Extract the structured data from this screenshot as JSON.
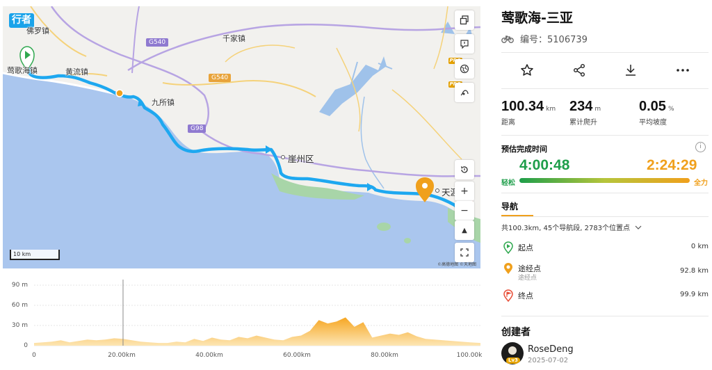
{
  "map": {
    "brand": "行者",
    "places": {
      "foluo": "佛罗镇",
      "yinggehai": "莺歌海镇",
      "huangliu": "黄流镇",
      "qianjia": "千家镇",
      "jiusuo": "九所镇",
      "yazhou": "崖州区",
      "tianya": "天涯"
    },
    "shields": {
      "g540a": "G540",
      "g540b": "G540",
      "g98": "G98"
    },
    "controls": {
      "layers_icon": "layers-icon",
      "note_icon": "note-icon",
      "globe_icon": "globe-icon",
      "terrain_icon": "terrain-icon",
      "reset_icon": "reset-icon",
      "zoom_in": "+",
      "zoom_out": "−",
      "north": "▲",
      "fullscreen_icon": "fullscreen-icon"
    },
    "pro_label": "PRO",
    "scale": "10 km",
    "attribution": "©高德地图   ©天地图",
    "colors": {
      "route": "#1ea8f0",
      "sea": "#aac6ee",
      "land": "#f2f1ee",
      "waypoint": "#f0a01c"
    }
  },
  "elevation": {
    "y_ticks": [
      "90 m",
      "60 m",
      "30 m",
      "0"
    ],
    "x_ticks": [
      "0",
      "20.00km",
      "40.00km",
      "60.00km",
      "80.00km",
      "100.00k"
    ],
    "fill_color": "#f7b731"
  },
  "chart_data": {
    "type": "area",
    "xlabel": "",
    "ylabel": "",
    "ylim": [
      0,
      90
    ],
    "xlim": [
      0,
      100.34
    ],
    "series": [
      {
        "x": [
          0,
          2,
          4,
          6,
          8,
          10,
          12,
          14,
          16,
          18,
          20,
          22,
          24,
          26,
          28,
          30,
          32,
          34,
          36,
          38,
          40,
          42,
          44,
          46,
          48,
          50,
          52,
          54,
          56,
          58,
          60,
          62,
          64,
          66,
          68,
          70,
          72,
          74,
          76,
          78,
          80,
          82,
          84,
          86,
          88,
          90,
          92,
          94,
          96,
          98,
          100.34
        ],
        "y": [
          4,
          5,
          6,
          8,
          5,
          7,
          9,
          8,
          9,
          11,
          10,
          8,
          6,
          5,
          4,
          4,
          6,
          5,
          10,
          7,
          12,
          9,
          8,
          13,
          11,
          15,
          12,
          9,
          8,
          13,
          15,
          22,
          38,
          33,
          36,
          42,
          28,
          35,
          12,
          15,
          18,
          16,
          20,
          14,
          10,
          9,
          8,
          7,
          6,
          5,
          4
        ]
      }
    ]
  },
  "cursor_km": 20,
  "panel": {
    "title": "莺歌海-三亚",
    "route_no": "编号：5106739",
    "actions": [
      "star-icon",
      "share-icon",
      "download-icon",
      "more-icon"
    ],
    "stats": [
      {
        "value": "100.34",
        "unit": "km",
        "label": "距离"
      },
      {
        "value": "234",
        "unit": "m",
        "label": "累计爬升"
      },
      {
        "value": "0.05",
        "unit": "%",
        "label": "平均坡度"
      }
    ],
    "eta": {
      "title": "预估完成时间",
      "easy_time": "4:00:48",
      "hard_time": "2:24:29",
      "easy_label": "轻松",
      "hard_label": "全力",
      "info": "i"
    },
    "nav": {
      "title": "导航",
      "summary": "共100.3km, 45个导航段, 2783个位置点",
      "waypoints": [
        {
          "name": "起点",
          "sub": "",
          "dist": "0 km",
          "color": "#2fa84f"
        },
        {
          "name": "途经点",
          "sub": "途经点",
          "dist": "92.8 km",
          "color": "#f0a01c"
        },
        {
          "name": "终点",
          "sub": "",
          "dist": "99.9 km",
          "color": "#e8503a"
        }
      ]
    },
    "creator": {
      "title": "创建者",
      "name": "RoseDeng",
      "date": "2025-07-02",
      "level": "Lv3"
    }
  }
}
